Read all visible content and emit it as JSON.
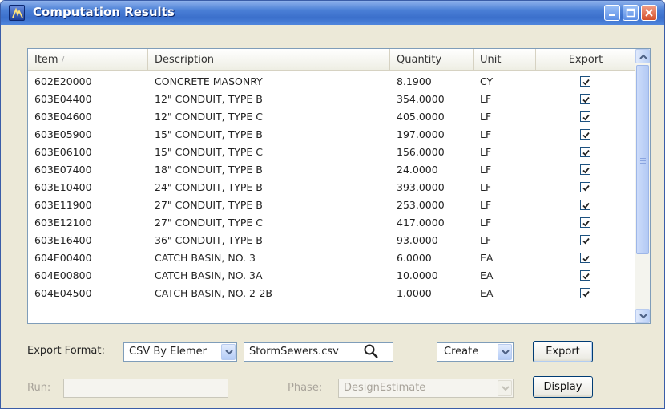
{
  "window": {
    "title": "Computation Results"
  },
  "columns": [
    {
      "label": "Item",
      "sort_indicator": "/"
    },
    {
      "label": "Description"
    },
    {
      "label": "Quantity"
    },
    {
      "label": "Unit"
    },
    {
      "label": "Export"
    }
  ],
  "rows": [
    {
      "item": "602E20000",
      "description": "CONCRETE MASONRY",
      "quantity": "8.1900",
      "unit": "CY",
      "export": true
    },
    {
      "item": "603E04400",
      "description": "12\" CONDUIT, TYPE B",
      "quantity": "354.0000",
      "unit": "LF",
      "export": true
    },
    {
      "item": "603E04600",
      "description": "12\" CONDUIT, TYPE C",
      "quantity": "405.0000",
      "unit": "LF",
      "export": true
    },
    {
      "item": "603E05900",
      "description": "15\" CONDUIT, TYPE B",
      "quantity": "197.0000",
      "unit": "LF",
      "export": true
    },
    {
      "item": "603E06100",
      "description": "15\" CONDUIT, TYPE C",
      "quantity": "156.0000",
      "unit": "LF",
      "export": true
    },
    {
      "item": "603E07400",
      "description": "18\" CONDUIT, TYPE B",
      "quantity": "24.0000",
      "unit": "LF",
      "export": true
    },
    {
      "item": "603E10400",
      "description": "24\" CONDUIT, TYPE B",
      "quantity": "393.0000",
      "unit": "LF",
      "export": true
    },
    {
      "item": "603E11900",
      "description": "27\" CONDUIT, TYPE B",
      "quantity": "253.0000",
      "unit": "LF",
      "export": true
    },
    {
      "item": "603E12100",
      "description": "27\" CONDUIT, TYPE C",
      "quantity": "417.0000",
      "unit": "LF",
      "export": true
    },
    {
      "item": "603E16400",
      "description": "36\" CONDUIT, TYPE B",
      "quantity": "93.0000",
      "unit": "LF",
      "export": true
    },
    {
      "item": "604E00400",
      "description": "CATCH BASIN, NO. 3",
      "quantity": "6.0000",
      "unit": "EA",
      "export": true
    },
    {
      "item": "604E00800",
      "description": "CATCH BASIN, NO. 3A",
      "quantity": "10.0000",
      "unit": "EA",
      "export": true
    },
    {
      "item": "604E04500",
      "description": "CATCH BASIN, NO. 2-2B",
      "quantity": "1.0000",
      "unit": "EA",
      "export": true
    }
  ],
  "controls": {
    "export_format_label": "Export Format:",
    "export_format_value": "CSV By Elemer",
    "filename_value": "StormSewers.csv",
    "mode_value": "Create",
    "export_button": "Export",
    "run_label": "Run:",
    "run_value": "",
    "phase_label": "Phase:",
    "phase_value": "DesignEstimate",
    "display_button": "Display"
  },
  "icons": {
    "app": "computation-results-app-icon",
    "minimize": "minimize-icon",
    "maximize": "maximize-icon",
    "close": "close-icon",
    "search": "magnifier-icon",
    "checkbox": "checkmark-icon"
  },
  "colors": {
    "titlebar": "#3b6fcb",
    "window_bg": "#ece9d8",
    "checkbox_border": "#1c5180"
  }
}
